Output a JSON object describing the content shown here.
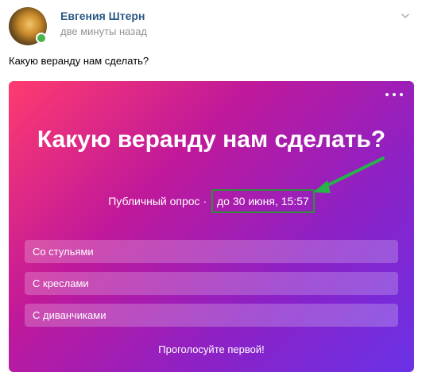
{
  "post": {
    "author": "Евгения Штерн",
    "time": "две минуты назад",
    "text": "Какую веранду нам сделать?",
    "more_icon": "chevron-down-icon"
  },
  "poll": {
    "title": "Какую веранду нам сделать?",
    "type_label": "Публичный опрос",
    "separator": "·",
    "deadline": "до 30 июня, 15:57",
    "options": [
      "Со стульями",
      "С креслами",
      "С диванчиками"
    ],
    "vote_label": "Проголосуйте первой!",
    "menu_icon": "more-horizontal-icon"
  },
  "colors": {
    "accent_link": "#2a5885",
    "online": "#4bb34b",
    "highlight_box": "#2e8f3a",
    "gradient_start": "#ff3b6f",
    "gradient_end": "#6a32e6"
  }
}
